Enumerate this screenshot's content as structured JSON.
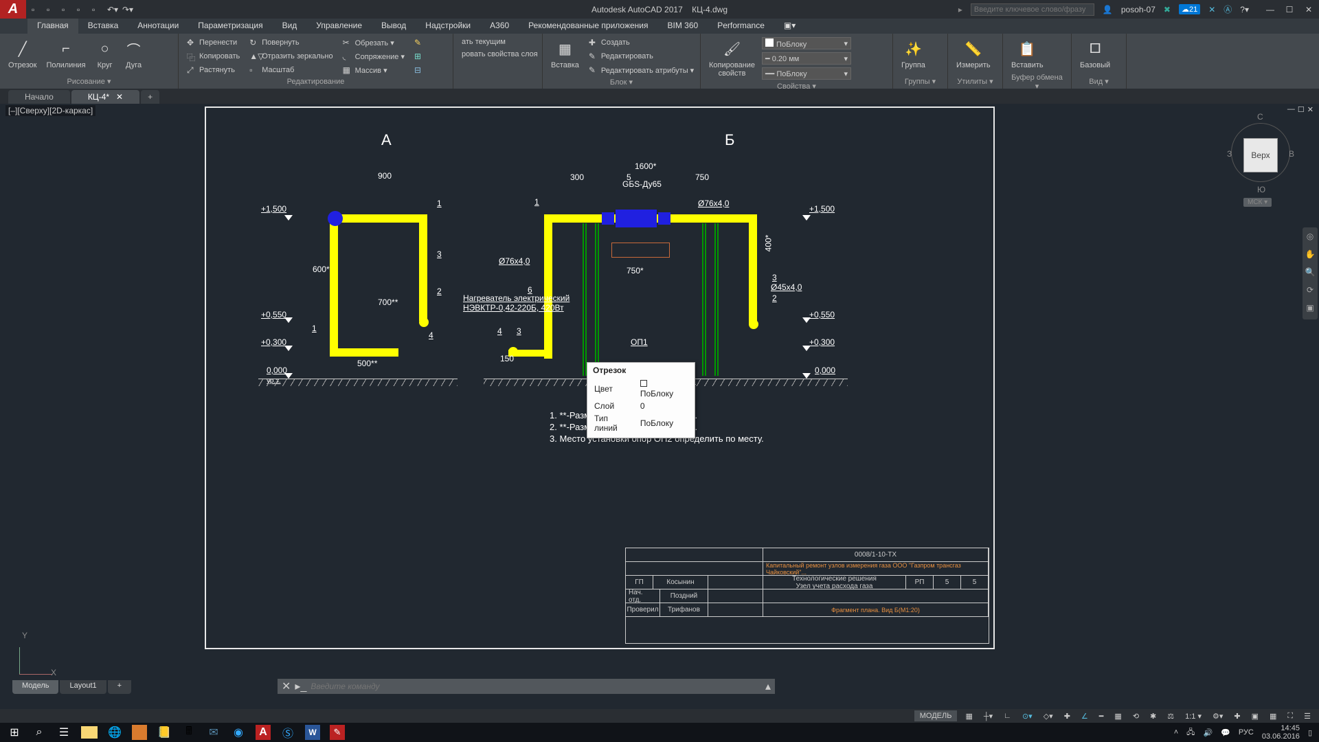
{
  "title": {
    "app": "Autodesk AutoCAD 2017",
    "file": "КЦ-4.dwg"
  },
  "search_placeholder": "Введите ключевое слово/фразу",
  "user": "posoh-07",
  "cloud_badge": "21",
  "menu_tabs": [
    "Главная",
    "Вставка",
    "Аннотации",
    "Параметризация",
    "Вид",
    "Управление",
    "Вывод",
    "Надстройки",
    "A360",
    "Рекомендованные приложения",
    "BIM 360",
    "Performance"
  ],
  "ribbon": {
    "draw": {
      "label": "Рисование ▾",
      "btns": [
        "Отрезок",
        "Полилиния",
        "Круг",
        "Дуга"
      ]
    },
    "edit": {
      "label": "Редактирование",
      "col1": [
        "Перенести",
        "Копировать",
        "Растянуть"
      ],
      "col2": [
        "Повернуть",
        "Отразить зеркально",
        "Масштаб"
      ],
      "col3": [
        "Обрезать ▾",
        "Сопряжение ▾",
        "Массив ▾"
      ]
    },
    "layers": {
      "label": "",
      "items": [
        "ать текущим",
        "ровать свойства слоя"
      ]
    },
    "block": {
      "label": "Блок ▾",
      "big": "Вставка",
      "items": [
        "Создать",
        "Редактировать",
        "Редактировать атрибуты ▾"
      ]
    },
    "props": {
      "label": "Свойства ▾",
      "big": "Копирование\nсвойств",
      "combo1": "ПоБлоку",
      "combo2": "0.20 мм",
      "combo3": "ПоБлоку"
    },
    "groups": {
      "label": "Группы ▾",
      "big": "Группа"
    },
    "utils": {
      "label": "Утилиты ▾",
      "big": "Измерить"
    },
    "clip": {
      "label": "Буфер обмена ▾",
      "big": "Вставить"
    },
    "view": {
      "label": "Вид ▾",
      "big": "Базовый"
    }
  },
  "doc_tabs": {
    "start": "Начало",
    "active": "КЦ-4*"
  },
  "viewport_label": "[–][Сверху][2D-каркас]",
  "viewcube": {
    "top": "Верх",
    "n": "С",
    "s": "Ю",
    "w": "З",
    "e": "В",
    "wcs": "МСК ▾"
  },
  "drawing": {
    "section_a": "А",
    "section_b": "Б",
    "dims_a": {
      "d900": "900",
      "d700": "700**",
      "d600": "600*",
      "d500": "500**",
      "l1500": "+1,500",
      "l0550": "+0,550",
      "l0300": "+0,300",
      "l0000": "0,000",
      "lyrз": "ур.з."
    },
    "dims_b": {
      "d1600": "1600*",
      "d300": "300",
      "d5": "5",
      "d750": "750",
      "d750b": "750*",
      "d150": "150",
      "d400": "400*",
      "l1500": "+1,500",
      "l0550": "+0,550",
      "l0300": "+0,300",
      "l0000": "0,000"
    },
    "labels": {
      "p76": "Ø76x4,0",
      "p76b": "Ø76x4,0",
      "p45": "Ø45x4,0",
      "gbs": "GБS-Ду65",
      "heater_t": "Нагреватель электрический",
      "heater_m": "НЭВКТР-0,42-220Б, 420Вт",
      "op1": "ОП1",
      "op2": "ОП2"
    },
    "notes": [
      "1. **-Размер уточнить при монтаже.",
      "2. **-Размер уточнить при монтаже.",
      "3. Место установки опор ОП2 определить по месту."
    ],
    "markers": {
      "m1": "1",
      "m2": "2",
      "m3": "3",
      "m4": "4",
      "m5": "5",
      "m6": "6"
    }
  },
  "tooltip": {
    "title": "Отрезок",
    "color_l": "Цвет",
    "color_v": "ПоБлоку",
    "layer_l": "Слой",
    "layer_v": "0",
    "lt_l": "Тип линий",
    "lt_v": "ПоБлоку"
  },
  "titleblock": {
    "code": "0008/1-10-ТХ",
    "desc1": "Технологические решения",
    "desc2": "Узел учета расхода газа",
    "rp": "РП",
    "n5a": "5",
    "n5b": "5",
    "sig": [
      "ГП",
      "Косынин",
      "Нач. отд.",
      "Поздний",
      "Проверил",
      "Трифанов"
    ]
  },
  "cmd_placeholder": "Введите команду",
  "bottom_tabs": [
    "Модель",
    "Layout1"
  ],
  "status": {
    "model": "МОДЕЛЬ",
    "scale": "1:1 ▾"
  },
  "tray": {
    "lang": "РУС",
    "time": "14:45",
    "date": "03.06.2016"
  }
}
